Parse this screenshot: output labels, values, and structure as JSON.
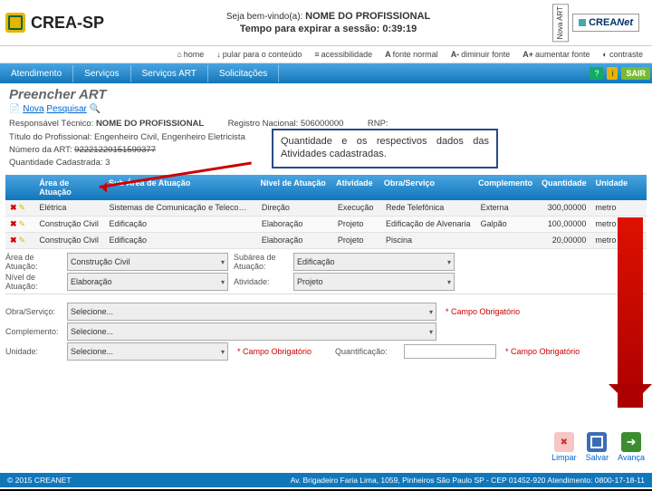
{
  "header": {
    "brand": "CREA-SP",
    "welcome_prefix": "Seja bem-vindo(a):",
    "welcome_name": "NOME DO PROFISSIONAL",
    "session_label": "Tempo para expirar a sessão: 0:39:19",
    "badge1": "Nova ART",
    "badge2_a": "CREA",
    "badge2_b": "Net"
  },
  "tools": {
    "home": "home",
    "skip": "pular para o conteúdo",
    "access": "acessibilidade",
    "fnorm": "fonte normal",
    "fdec": "diminuir fonte",
    "finc": "aumentar fonte",
    "contrast": "contraste"
  },
  "menu": {
    "m1": "Atendimento",
    "m2": "Serviços",
    "m3": "Serviços ART",
    "m4": "Solicitações",
    "help": "?",
    "info": "i",
    "exit": "SAIR"
  },
  "title": "Preencher ART",
  "crumbs": {
    "a": "Nova",
    "b": "Pesquisar"
  },
  "info": {
    "resp_label": "Responsável Técnico:",
    "resp_val": "NOME DO PROFISSIONAL",
    "reg_label": "Registro Nacional:",
    "reg_val": "506000000",
    "rnp": "RNP:",
    "titulo": "Título do Profissional: Engenheiro Civil, Engenheiro Eletricista",
    "numart_label": "Número da ART:",
    "numart_val": "92221220151599377",
    "qtd_label": "Quantidade Cadastrada:",
    "qtd_val": "3"
  },
  "thead": {
    "area": "Área de Atuação",
    "sub": "Sub Área de Atuação",
    "niv": "Nível de Atuação",
    "atv": "Atividade",
    "obra": "Obra/Serviço",
    "comp": "Complemento",
    "qtd": "Quantidade",
    "uni": "Unidade"
  },
  "rows": [
    {
      "area": "Elétrica",
      "sub": "Sistemas de Comunicação e Telecomunicação",
      "niv": "Direção",
      "atv": "Execução",
      "obra": "Rede Telefônica",
      "comp": "Externa",
      "qtd": "300,00000",
      "uni": "metro"
    },
    {
      "area": "Construção Civil",
      "sub": "Edificação",
      "niv": "Elaboração",
      "atv": "Projeto",
      "obra": "Edificação de Alvenaria",
      "comp": "Galpão",
      "qtd": "100,00000",
      "uni": "metro quadrado"
    },
    {
      "area": "Construção Civil",
      "sub": "Edificação",
      "niv": "Elaboração",
      "atv": "Projeto",
      "obra": "Piscina",
      "comp": "",
      "qtd": "20,00000",
      "uni": "metro quadrado"
    }
  ],
  "form": {
    "area_l": "Área de Atuação:",
    "area_v": "Construção Civil",
    "sub_l": "Subárea de Atuação:",
    "sub_v": "Edificação",
    "niv_l": "Nível de Atuação:",
    "niv_v": "Elaboração",
    "atv_l": "Atividade:",
    "atv_v": "Projeto",
    "obra_l": "Obra/Serviço:",
    "obra_v": "Selecione...",
    "obra_req": "* Campo Obrigatório",
    "comp_l": "Complemento:",
    "comp_v": "Selecione...",
    "uni_l": "Unidade:",
    "uni_v": "Selecione...",
    "uni_req": "* Campo Obrigatório",
    "qtd_l": "Quantificação:",
    "qtd_req": "* Campo Obrigatório"
  },
  "annot": "Quantidade e os respectivos dados das Atividades cadastradas.",
  "actions": {
    "clear": "Limpar",
    "save": "Salvar",
    "go": "Avança"
  },
  "footer": {
    "left": "© 2015 CREANET",
    "right": "Av. Brigadeiro Faria Lima, 1059, Pinheiros São Paulo SP - CEP 01452-920 Atendimento: 0800-17-18-11"
  }
}
